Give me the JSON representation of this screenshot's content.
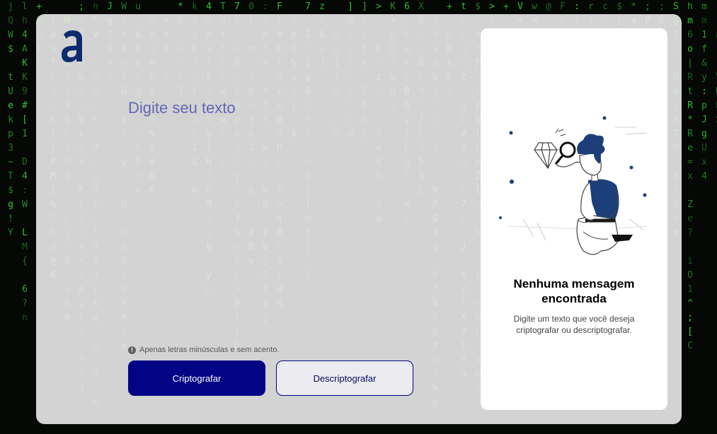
{
  "brand": {
    "logo_letter": "a",
    "color": "#0d2b6e"
  },
  "input": {
    "placeholder": "Digite seu texto",
    "value": ""
  },
  "hint": {
    "icon": "info-icon",
    "text": "Apenas letras minúsculas e sem acento."
  },
  "buttons": {
    "encrypt_label": "Criptografar",
    "decrypt_label": "Descriptografar"
  },
  "result": {
    "title": "Nenhuma mensagem encontrada",
    "description": "Digite um texto que você deseja criptografar ou descriptografar.",
    "illustration": "boy-with-magnifying-glass-and-diamond"
  },
  "colors": {
    "primary": "#020385",
    "placeholder": "#6466b8",
    "matrix_green": "#35d435",
    "background": "#050805"
  }
}
